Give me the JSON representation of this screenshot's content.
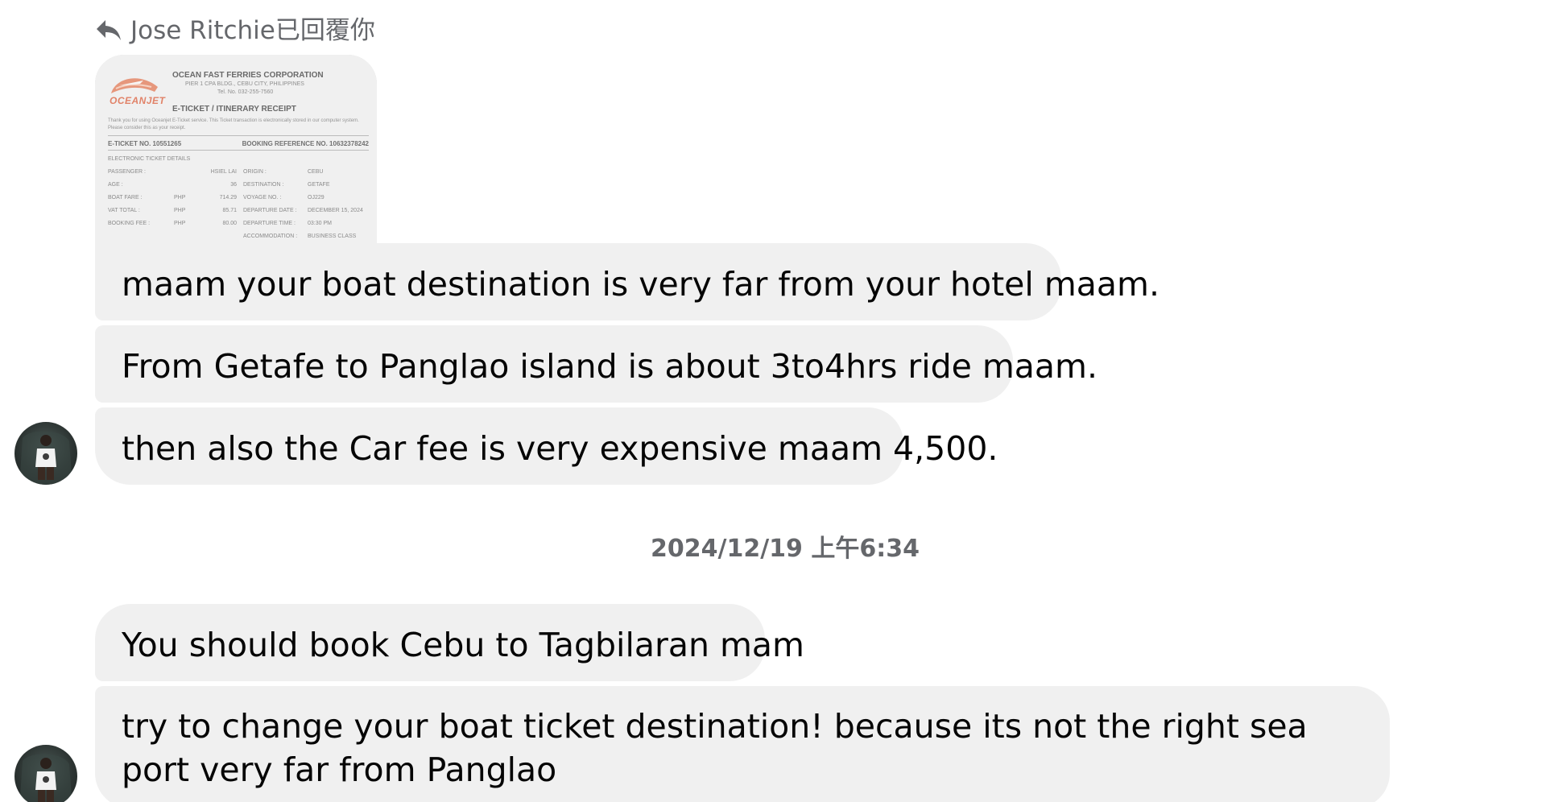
{
  "reply_header": {
    "icon": "reply-arrow-icon",
    "text": "Jose Ritchie已回覆你"
  },
  "quoted_ticket": {
    "logo_text": "OCEANJET",
    "company": "OCEAN FAST FERRIES CORPORATION",
    "address": "PIER 1 CPA BLDG., CEBU CITY, PHILIPPINES",
    "tel": "Tel. No. 032-255-7560",
    "title": "E-TICKET / ITINERARY RECEIPT",
    "note": "Thank you for using Oceanjet E-Ticket service. This Ticket transaction is electronically stored in our computer system. Please consider this as your receipt.",
    "eticket_no": "E-TICKET NO.  10551265",
    "booking_ref": "BOOKING REFERENCE NO.  10632378242",
    "section": "ELECTRONIC TICKET DETAILS",
    "rows": [
      {
        "l1": "PASSENGER :",
        "l2": "",
        "v1": "HSIEL LAI",
        "l3": "ORIGIN :",
        "v2": "CEBU"
      },
      {
        "l1": "AGE :",
        "l2": "",
        "v1": "36",
        "l3": "DESTINATION :",
        "v2": "GETAFE"
      },
      {
        "l1": "BOAT FARE :",
        "l2": "PHP",
        "v1": "714.29",
        "l3": "VOYAGE NO. :",
        "v2": "OJ229"
      },
      {
        "l1": "VAT TOTAL :",
        "l2": "PHP",
        "v1": "85.71",
        "l3": "DEPARTURE DATE :",
        "v2": "DECEMBER 15, 2024"
      },
      {
        "l1": "BOOKING FEE :",
        "l2": "PHP",
        "v1": "80.00",
        "l3": "DEPARTURE TIME :",
        "v2": "03:30 PM"
      },
      {
        "l1": "",
        "l2": "",
        "v1": "",
        "l3": "ACCOMMODATION :",
        "v2": "BUSINESS CLASS"
      }
    ]
  },
  "messages": [
    {
      "text": "maam your boat destination is very far from your hotel maam."
    },
    {
      "text": "From Getafe to Panglao island is about 3to4hrs ride maam."
    },
    {
      "text": "then also the Car fee is very expensive maam 4,500."
    },
    {
      "text": "You should book Cebu to Tagbilaran mam"
    },
    {
      "text": "try to change your boat ticket destination!  because its not the right sea port very far from Panglao"
    }
  ],
  "timestamp": "2024/12/19 上午6:34",
  "colors": {
    "bubble_bg": "#f0f0f0",
    "meta_text": "#65676b",
    "message_text": "#050505"
  }
}
